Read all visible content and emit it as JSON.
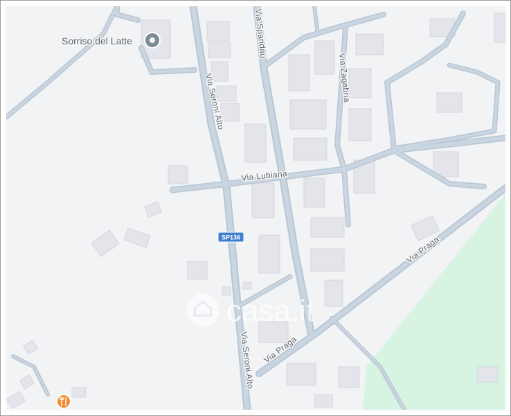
{
  "map": {
    "poi": {
      "name": "Sorriso del Latte",
      "icon": "location-pin-icon"
    },
    "restaurant_icon": "fork-knife-icon",
    "road_labels": {
      "via_seroni_alto_top": "Via Seroni Alto",
      "via_seroni_alto_bottom": "Via Seroni Alto",
      "via_spandau": "Via Spandau",
      "via_zagabria": "Via Zagabria",
      "via_lubiana": "Via Lubiana",
      "via_praga_top": "Via Praga",
      "via_praga_bottom": "Via Praga"
    },
    "route_shield": {
      "label": "SP136",
      "color": "#3f7fd0"
    },
    "watermark": {
      "text": "casa.it",
      "icon": "house-icon"
    },
    "colors": {
      "background": "#f2f3f5",
      "road": "#c9d5e0",
      "building": "#e3e5ea",
      "park": "#d7f4e3",
      "label": "#5f6368"
    }
  }
}
